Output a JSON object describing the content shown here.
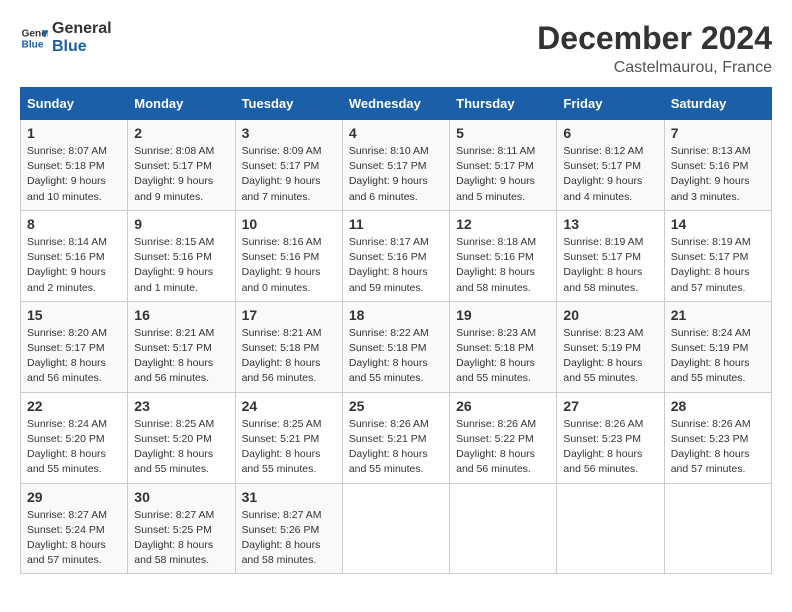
{
  "header": {
    "logo_line1": "General",
    "logo_line2": "Blue",
    "month_year": "December 2024",
    "location": "Castelmaurou, France"
  },
  "days_of_week": [
    "Sunday",
    "Monday",
    "Tuesday",
    "Wednesday",
    "Thursday",
    "Friday",
    "Saturday"
  ],
  "weeks": [
    [
      {
        "day": "1",
        "info": "Sunrise: 8:07 AM\nSunset: 5:18 PM\nDaylight: 9 hours\nand 10 minutes."
      },
      {
        "day": "2",
        "info": "Sunrise: 8:08 AM\nSunset: 5:17 PM\nDaylight: 9 hours\nand 9 minutes."
      },
      {
        "day": "3",
        "info": "Sunrise: 8:09 AM\nSunset: 5:17 PM\nDaylight: 9 hours\nand 7 minutes."
      },
      {
        "day": "4",
        "info": "Sunrise: 8:10 AM\nSunset: 5:17 PM\nDaylight: 9 hours\nand 6 minutes."
      },
      {
        "day": "5",
        "info": "Sunrise: 8:11 AM\nSunset: 5:17 PM\nDaylight: 9 hours\nand 5 minutes."
      },
      {
        "day": "6",
        "info": "Sunrise: 8:12 AM\nSunset: 5:17 PM\nDaylight: 9 hours\nand 4 minutes."
      },
      {
        "day": "7",
        "info": "Sunrise: 8:13 AM\nSunset: 5:16 PM\nDaylight: 9 hours\nand 3 minutes."
      }
    ],
    [
      {
        "day": "8",
        "info": "Sunrise: 8:14 AM\nSunset: 5:16 PM\nDaylight: 9 hours\nand 2 minutes."
      },
      {
        "day": "9",
        "info": "Sunrise: 8:15 AM\nSunset: 5:16 PM\nDaylight: 9 hours\nand 1 minute."
      },
      {
        "day": "10",
        "info": "Sunrise: 8:16 AM\nSunset: 5:16 PM\nDaylight: 9 hours\nand 0 minutes."
      },
      {
        "day": "11",
        "info": "Sunrise: 8:17 AM\nSunset: 5:16 PM\nDaylight: 8 hours\nand 59 minutes."
      },
      {
        "day": "12",
        "info": "Sunrise: 8:18 AM\nSunset: 5:16 PM\nDaylight: 8 hours\nand 58 minutes."
      },
      {
        "day": "13",
        "info": "Sunrise: 8:19 AM\nSunset: 5:17 PM\nDaylight: 8 hours\nand 58 minutes."
      },
      {
        "day": "14",
        "info": "Sunrise: 8:19 AM\nSunset: 5:17 PM\nDaylight: 8 hours\nand 57 minutes."
      }
    ],
    [
      {
        "day": "15",
        "info": "Sunrise: 8:20 AM\nSunset: 5:17 PM\nDaylight: 8 hours\nand 56 minutes."
      },
      {
        "day": "16",
        "info": "Sunrise: 8:21 AM\nSunset: 5:17 PM\nDaylight: 8 hours\nand 56 minutes."
      },
      {
        "day": "17",
        "info": "Sunrise: 8:21 AM\nSunset: 5:18 PM\nDaylight: 8 hours\nand 56 minutes."
      },
      {
        "day": "18",
        "info": "Sunrise: 8:22 AM\nSunset: 5:18 PM\nDaylight: 8 hours\nand 55 minutes."
      },
      {
        "day": "19",
        "info": "Sunrise: 8:23 AM\nSunset: 5:18 PM\nDaylight: 8 hours\nand 55 minutes."
      },
      {
        "day": "20",
        "info": "Sunrise: 8:23 AM\nSunset: 5:19 PM\nDaylight: 8 hours\nand 55 minutes."
      },
      {
        "day": "21",
        "info": "Sunrise: 8:24 AM\nSunset: 5:19 PM\nDaylight: 8 hours\nand 55 minutes."
      }
    ],
    [
      {
        "day": "22",
        "info": "Sunrise: 8:24 AM\nSunset: 5:20 PM\nDaylight: 8 hours\nand 55 minutes."
      },
      {
        "day": "23",
        "info": "Sunrise: 8:25 AM\nSunset: 5:20 PM\nDaylight: 8 hours\nand 55 minutes."
      },
      {
        "day": "24",
        "info": "Sunrise: 8:25 AM\nSunset: 5:21 PM\nDaylight: 8 hours\nand 55 minutes."
      },
      {
        "day": "25",
        "info": "Sunrise: 8:26 AM\nSunset: 5:21 PM\nDaylight: 8 hours\nand 55 minutes."
      },
      {
        "day": "26",
        "info": "Sunrise: 8:26 AM\nSunset: 5:22 PM\nDaylight: 8 hours\nand 56 minutes."
      },
      {
        "day": "27",
        "info": "Sunrise: 8:26 AM\nSunset: 5:23 PM\nDaylight: 8 hours\nand 56 minutes."
      },
      {
        "day": "28",
        "info": "Sunrise: 8:26 AM\nSunset: 5:23 PM\nDaylight: 8 hours\nand 57 minutes."
      }
    ],
    [
      {
        "day": "29",
        "info": "Sunrise: 8:27 AM\nSunset: 5:24 PM\nDaylight: 8 hours\nand 57 minutes."
      },
      {
        "day": "30",
        "info": "Sunrise: 8:27 AM\nSunset: 5:25 PM\nDaylight: 8 hours\nand 58 minutes."
      },
      {
        "day": "31",
        "info": "Sunrise: 8:27 AM\nSunset: 5:26 PM\nDaylight: 8 hours\nand 58 minutes."
      },
      {
        "day": "",
        "info": ""
      },
      {
        "day": "",
        "info": ""
      },
      {
        "day": "",
        "info": ""
      },
      {
        "day": "",
        "info": ""
      }
    ]
  ]
}
